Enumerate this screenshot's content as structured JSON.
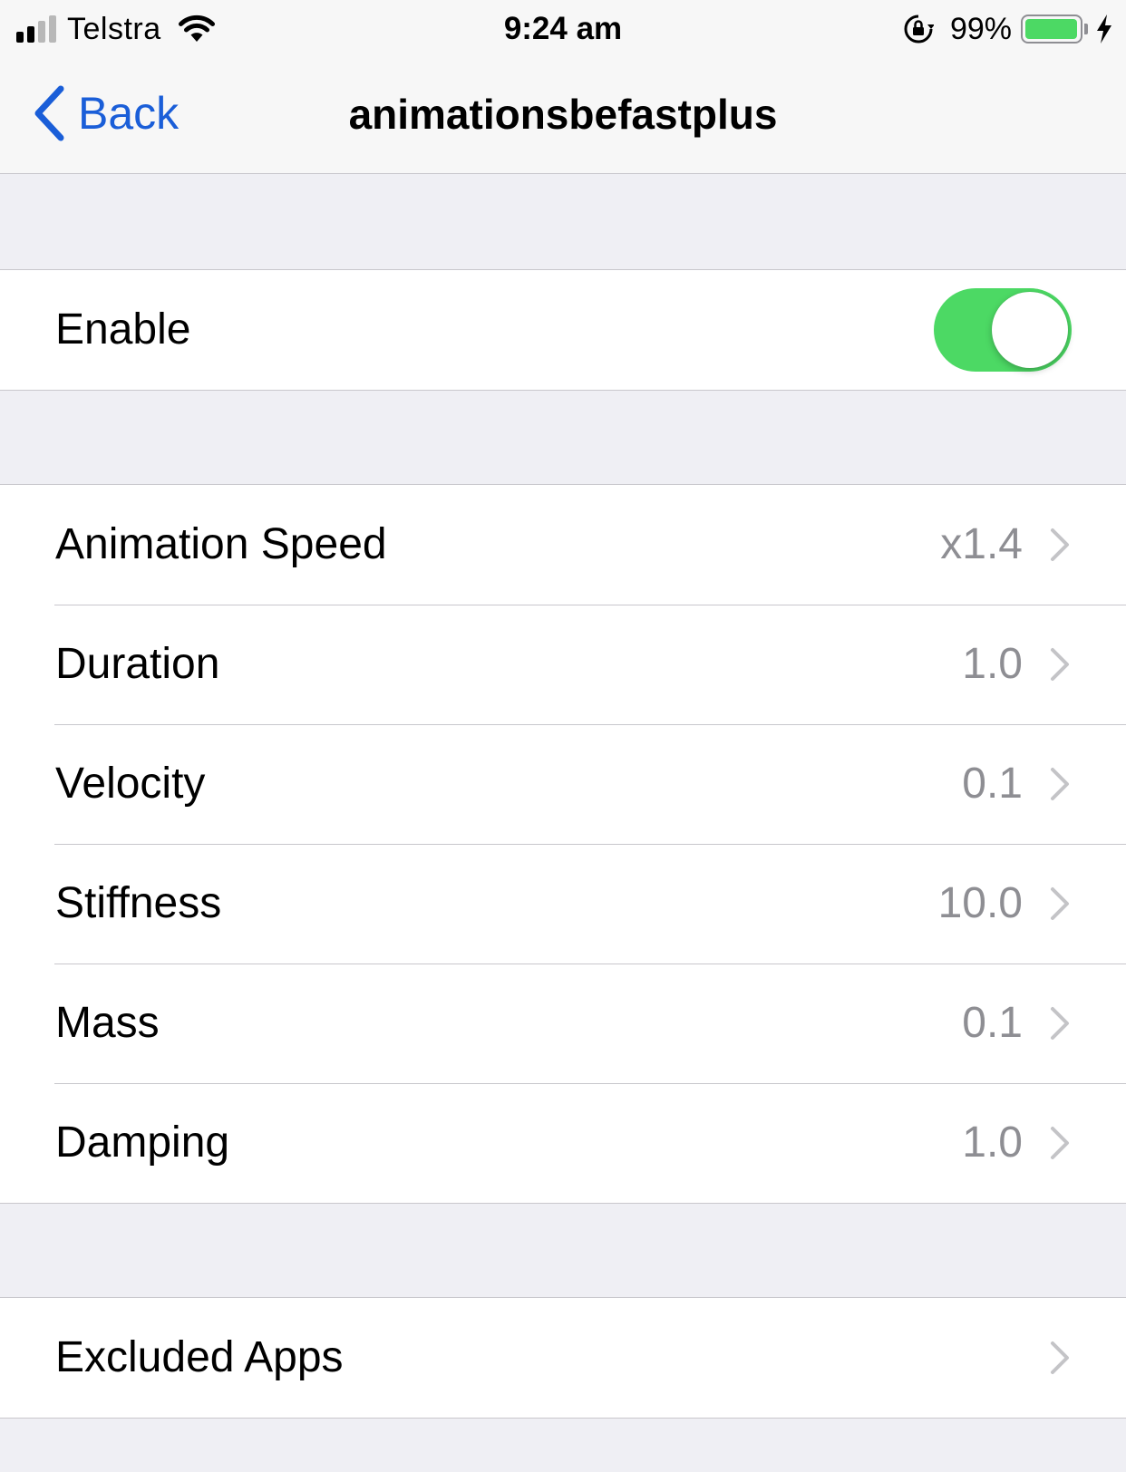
{
  "status_bar": {
    "carrier": "Telstra",
    "time": "9:24 am",
    "battery_percent": "99%",
    "battery_level": 0.99,
    "charging": true,
    "orientation_lock": true,
    "signal_bars_active": 2,
    "signal_bars_total": 4
  },
  "nav": {
    "back_label": "Back",
    "title": "animationsbefastplus"
  },
  "enable_group": {
    "label": "Enable",
    "toggle_on": true
  },
  "settings": [
    {
      "label": "Animation Speed",
      "value": "x1.4"
    },
    {
      "label": "Duration",
      "value": "1.0"
    },
    {
      "label": "Velocity",
      "value": "0.1"
    },
    {
      "label": "Stiffness",
      "value": "10.0"
    },
    {
      "label": "Mass",
      "value": "0.1"
    },
    {
      "label": "Damping",
      "value": "1.0"
    }
  ],
  "excluded_group": {
    "label": "Excluded Apps"
  },
  "colors": {
    "accent": "#1a5ed8",
    "toggle_on": "#4cd964",
    "battery": "#4cd964",
    "secondary_text": "#8e8e93",
    "background": "#efeff4"
  }
}
